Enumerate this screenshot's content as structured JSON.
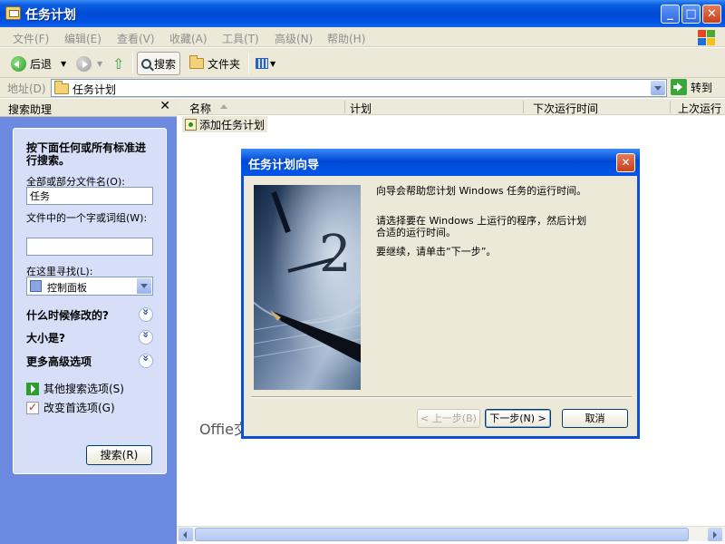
{
  "window": {
    "title": "任务计划"
  },
  "menubar": {
    "items": [
      "文件(F)",
      "编辑(E)",
      "查看(V)",
      "收藏(A)",
      "工具(T)",
      "高级(N)",
      "帮助(H)"
    ]
  },
  "toolbar": {
    "back": "后退",
    "search": "搜索",
    "folders": "文件夹"
  },
  "address": {
    "label": "地址(D)",
    "value": "任务计划",
    "go": "转到"
  },
  "search_pane": {
    "title": "搜索助理",
    "intro": "按下面任何或所有标准进行搜索。",
    "filename_label": "全部或部分文件名(O):",
    "filename_value": "任务",
    "phrase_label": "文件中的一个字或词组(W):",
    "phrase_value": "",
    "lookin_label": "在这里寻找(L):",
    "lookin_value": "控制面板",
    "when_modified": "什么时候修改的?",
    "size": "大小是?",
    "advanced": "更多高级选项",
    "other_options": "其他搜索选项(S)",
    "change_prefs": "改变首选项(G)",
    "search_button": "搜索(R)"
  },
  "list": {
    "columns": [
      "名称",
      "计划",
      "下次运行时间",
      "上次运行"
    ],
    "items": [
      "添加任务计划"
    ]
  },
  "watermark": "Offie交流网-www.office-cn.net",
  "dialog": {
    "title": "任务计划向导",
    "p1": "向导会帮助您计划 Windows 任务的运行时间。",
    "p2": "请选择要在 Windows 上运行的程序，然后计划合适的运行时间。",
    "p3": "要继续，请单击“下一步”。",
    "back": "< 上一步(B)",
    "next": "下一步(N) >",
    "cancel": "取消"
  }
}
